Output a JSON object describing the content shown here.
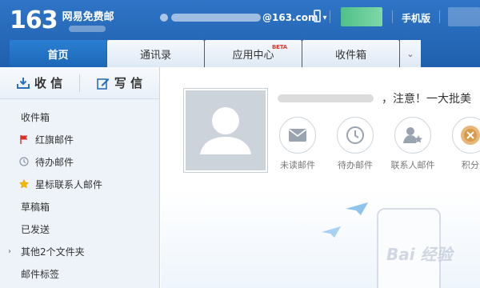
{
  "header": {
    "logo_number": "163",
    "logo_text": "网易免费邮",
    "email_domain": "@163.com",
    "mobile_label": "手机版"
  },
  "tabs": [
    {
      "label": "首页"
    },
    {
      "label": "通讯录"
    },
    {
      "label": "应用中心",
      "badge": "BETA"
    },
    {
      "label": "收件箱"
    }
  ],
  "compose": {
    "receive_label": "收 信",
    "write_label": "写 信"
  },
  "folders": [
    {
      "label": "收件箱"
    },
    {
      "label": "红旗邮件",
      "icon": "flag-icon"
    },
    {
      "label": "待办邮件",
      "icon": "clock-icon"
    },
    {
      "label": "星标联系人邮件",
      "icon": "star-icon"
    },
    {
      "label": "草稿箱"
    },
    {
      "label": "已发送"
    },
    {
      "label": "其他2个文件夹",
      "expandable": true
    },
    {
      "label": "邮件标签"
    }
  ],
  "main": {
    "greeting": "，注意！一大批美",
    "quick_links": [
      {
        "label": "未读邮件",
        "icon": "envelope-icon"
      },
      {
        "label": "待办邮件",
        "icon": "clock-icon"
      },
      {
        "label": "联系人邮件",
        "icon": "contact-star-icon"
      },
      {
        "label": "积分",
        "icon": "points-icon"
      }
    ],
    "watermark": "Bai 经验"
  },
  "colors": {
    "header_blue": "#2f74c6",
    "tab_active": "#1d67b7",
    "sidebar_bg": "#eef3f9",
    "flag_red": "#d9302a",
    "star_yellow": "#f5b800"
  }
}
